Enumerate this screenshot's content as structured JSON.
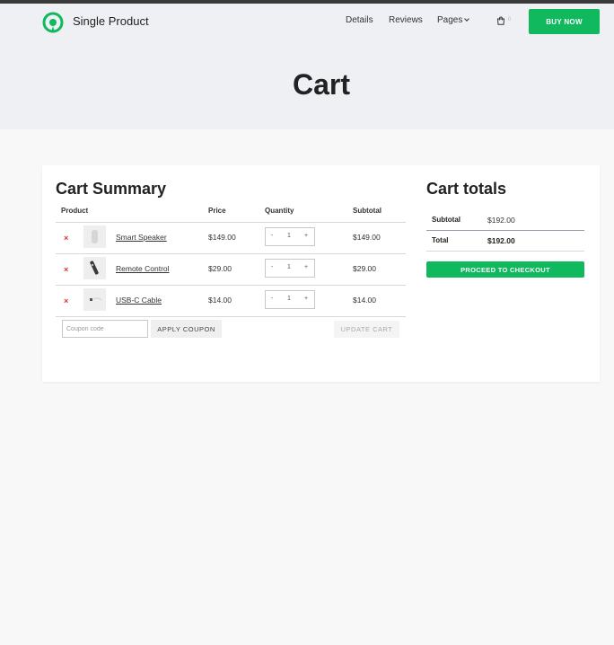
{
  "header": {
    "brand": "Single Product",
    "nav": {
      "details": "Details",
      "reviews": "Reviews",
      "pages": "Pages"
    },
    "cart_count": "0",
    "buy_now": "BUY NOW",
    "icons": {
      "logo": "location-pin-logo",
      "cart": "shopping-bag-icon",
      "pages_dropdown": "chevron-down-icon"
    }
  },
  "page_title": "Cart",
  "cart_summary": {
    "title": "Cart Summary",
    "columns": {
      "product": "Product",
      "price": "Price",
      "quantity": "Quantity",
      "subtotal": "Subtotal"
    },
    "items": [
      {
        "remove": "×",
        "name": "Smart Speaker",
        "price": "$149.00",
        "qty": "1",
        "qty_minus": "-",
        "qty_plus": "+",
        "subtotal": "$149.00"
      },
      {
        "remove": "×",
        "name": "Remote Control",
        "price": "$29.00",
        "qty": "1",
        "qty_minus": "-",
        "qty_plus": "+",
        "subtotal": "$29.00"
      },
      {
        "remove": "×",
        "name": "USB-C Cable",
        "price": "$14.00",
        "qty": "1",
        "qty_minus": "-",
        "qty_plus": "+",
        "subtotal": "$14.00"
      }
    ],
    "coupon_placeholder": "Coupon code",
    "apply_coupon": "APPLY COUPON",
    "update_cart": "UPDATE CART"
  },
  "cart_totals": {
    "title": "Cart totals",
    "subtotal_label": "Subtotal",
    "subtotal_value": "$192.00",
    "total_label": "Total",
    "total_value": "$192.00",
    "checkout": "PROCEED TO CHECKOUT"
  },
  "colors": {
    "accent": "#10b85e",
    "remove": "#dd3322",
    "header_bg": "#eff0f3",
    "topbar": "#3a3a3a"
  }
}
